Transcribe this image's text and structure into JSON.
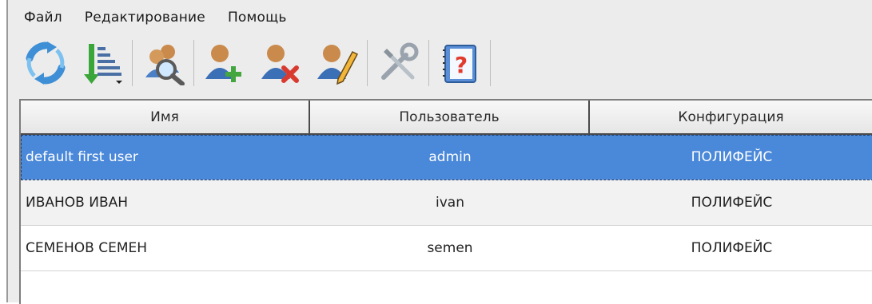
{
  "menu": [
    "Файл",
    "Редактирование",
    "Помощь"
  ],
  "toolbar": {
    "icons": [
      "refresh-icon",
      "sort-list-icon",
      "search-users-icon",
      "add-user-icon",
      "delete-user-icon",
      "edit-user-icon",
      "settings-tools-icon",
      "help-book-icon"
    ]
  },
  "table": {
    "columns": [
      "Имя",
      "Пользователь",
      "Конфигурация"
    ],
    "rows": [
      {
        "name": "default first user",
        "user": "admin",
        "config": "ПОЛИФЕЙС"
      },
      {
        "name": "ИВАНОВ ИВАН",
        "user": "ivan",
        "config": "ПОЛИФЕЙС"
      },
      {
        "name": "СЕМЕНОВ СЕМЕН",
        "user": "semen",
        "config": "ПОЛИФЕЙС"
      }
    ],
    "selected_row": 0
  },
  "colors": {
    "selection": "#4a88d9",
    "toolbar_bg": "#ececec",
    "header_border": "#4a4a4a"
  }
}
